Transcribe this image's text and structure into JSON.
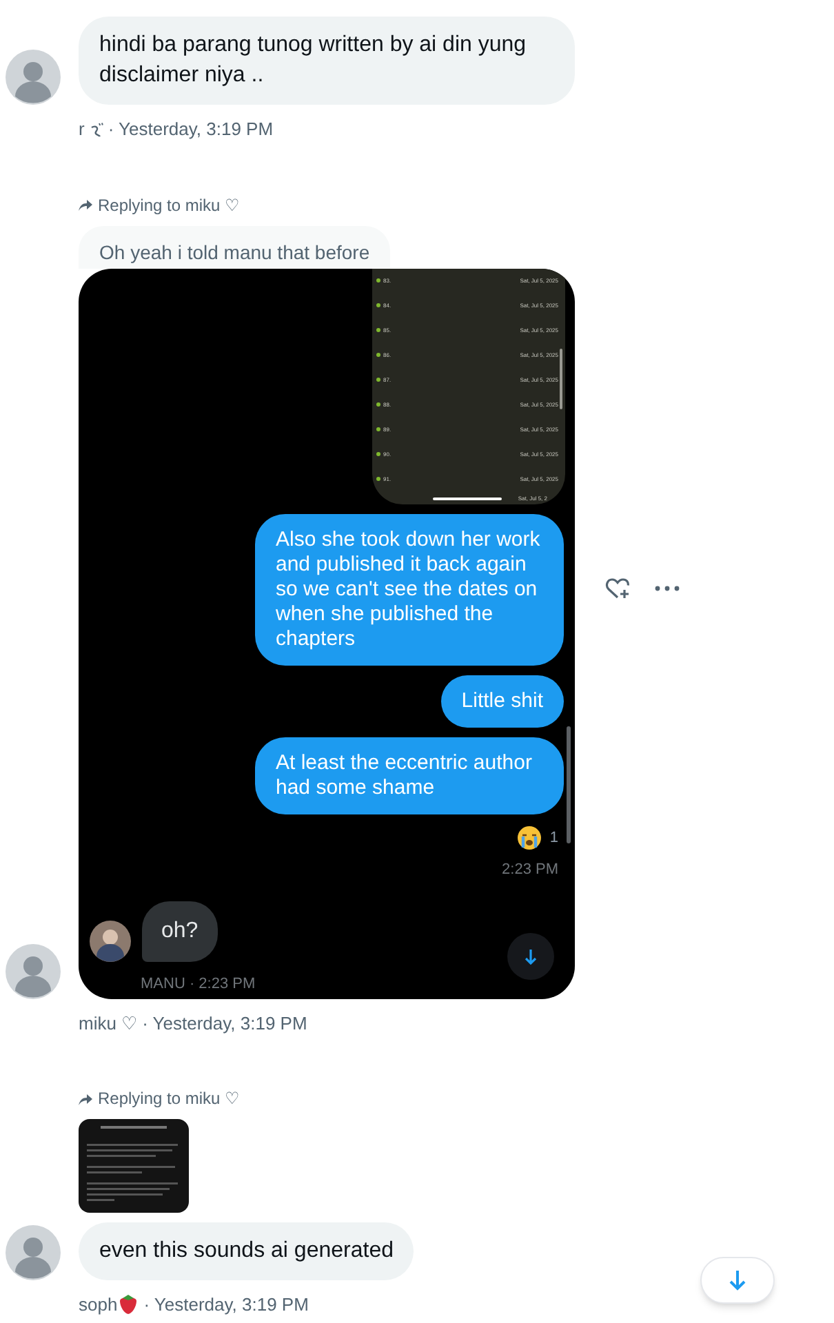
{
  "messages": [
    {
      "bubble": {
        "text": "hindi ba parang tunog written by ai din yung disclaimer niya .."
      },
      "meta": {
        "kind": "squiggle",
        "author": "r",
        "time": "· Yesterday, 3:19 PM"
      }
    },
    {
      "reply_to": "Replying to miku ♡",
      "quote": "Oh yeah i told manu that before",
      "attachment": {
        "kind": "chat_screenshot",
        "list_rows": [
          {
            "number": "83.",
            "date": "Sat, Jul 5, 2025"
          },
          {
            "number": "84.",
            "date": "Sat, Jul 5, 2025"
          },
          {
            "number": "85.",
            "date": "Sat, Jul 5, 2025"
          },
          {
            "number": "86.",
            "date": "Sat, Jul 5, 2025"
          },
          {
            "number": "87.",
            "date": "Sat, Jul 5, 2025"
          },
          {
            "number": "88.",
            "date": "Sat, Jul 5, 2025"
          },
          {
            "number": "89.",
            "date": "Sat, Jul 5, 2025"
          },
          {
            "number": "90.",
            "date": "Sat, Jul 5, 2025"
          },
          {
            "number": "91.",
            "date": "Sat, Jul 5, 2025"
          }
        ],
        "list_cut_date": "Sat, Jul 5, 2",
        "sent": [
          "Also she took down her work and published it back again so we can't see the dates on when she published the chapters",
          "Little shit",
          "At least the eccentric author had some shame"
        ],
        "reaction_count": "1",
        "sent_time": "2:23 PM",
        "received_text": "oh?",
        "received_meta": "MANU · 2:23 PM"
      },
      "meta": {
        "kind": "plain",
        "author": "miku ♡",
        "time": "· Yesterday, 3:19 PM"
      },
      "actions": true
    },
    {
      "reply_to": "Replying to miku ♡",
      "bubble": {
        "text": "even this sounds ai generated"
      },
      "meta": {
        "kind": "strawberry",
        "author": "soph",
        "time": "· Yesterday, 3:19 PM"
      }
    }
  ]
}
